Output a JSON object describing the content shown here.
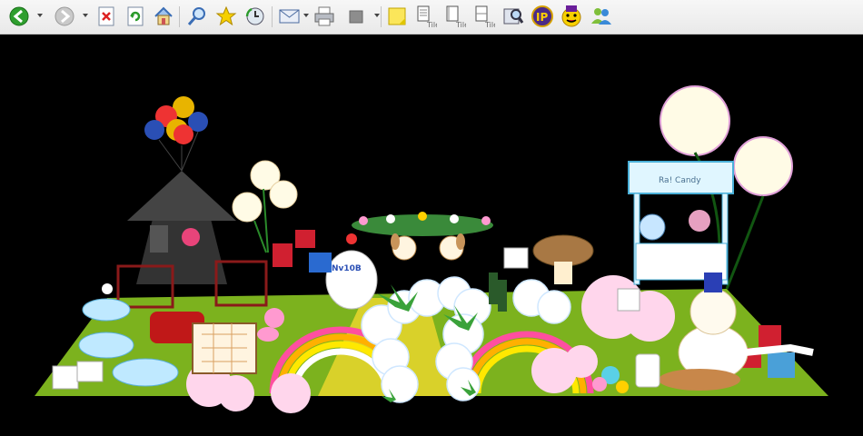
{
  "toolbar": {
    "buttons": [
      {
        "name": "back",
        "icon": "back-arrow-icon",
        "dropdown": true
      },
      {
        "name": "forward",
        "icon": "forward-arrow-icon",
        "dropdown": true
      },
      {
        "name": "stop",
        "icon": "stop-icon"
      },
      {
        "name": "refresh",
        "icon": "refresh-icon"
      },
      {
        "name": "home",
        "icon": "home-icon"
      },
      {
        "name": "search",
        "icon": "magnifier-icon"
      },
      {
        "name": "favorites",
        "icon": "star-icon"
      },
      {
        "name": "history",
        "icon": "history-icon"
      },
      {
        "name": "mail",
        "icon": "mail-icon",
        "dropdown": true
      },
      {
        "name": "print",
        "icon": "printer-icon"
      },
      {
        "name": "edit",
        "icon": "edit-icon",
        "dropdown": true
      },
      {
        "name": "notes",
        "icon": "sticky-note-icon"
      },
      {
        "name": "page-1",
        "icon": "page-icon"
      },
      {
        "name": "page-2",
        "icon": "page-icon"
      },
      {
        "name": "page-3",
        "icon": "page-icon"
      },
      {
        "name": "research",
        "icon": "research-icon"
      },
      {
        "name": "messenger",
        "icon": "messenger-icon"
      },
      {
        "name": "yahoo-messenger",
        "icon": "smiley-icon"
      },
      {
        "name": "msn-messenger",
        "icon": "people-icon"
      }
    ]
  },
  "scene": {
    "description_icon": "virtual-room-scene",
    "labels": {
      "jar_label": "Nv10B",
      "cart_sign": "Ra! Candy"
    },
    "colors": {
      "grass": "#7cb21e",
      "path": "#d9d12a",
      "background": "#000000"
    }
  }
}
